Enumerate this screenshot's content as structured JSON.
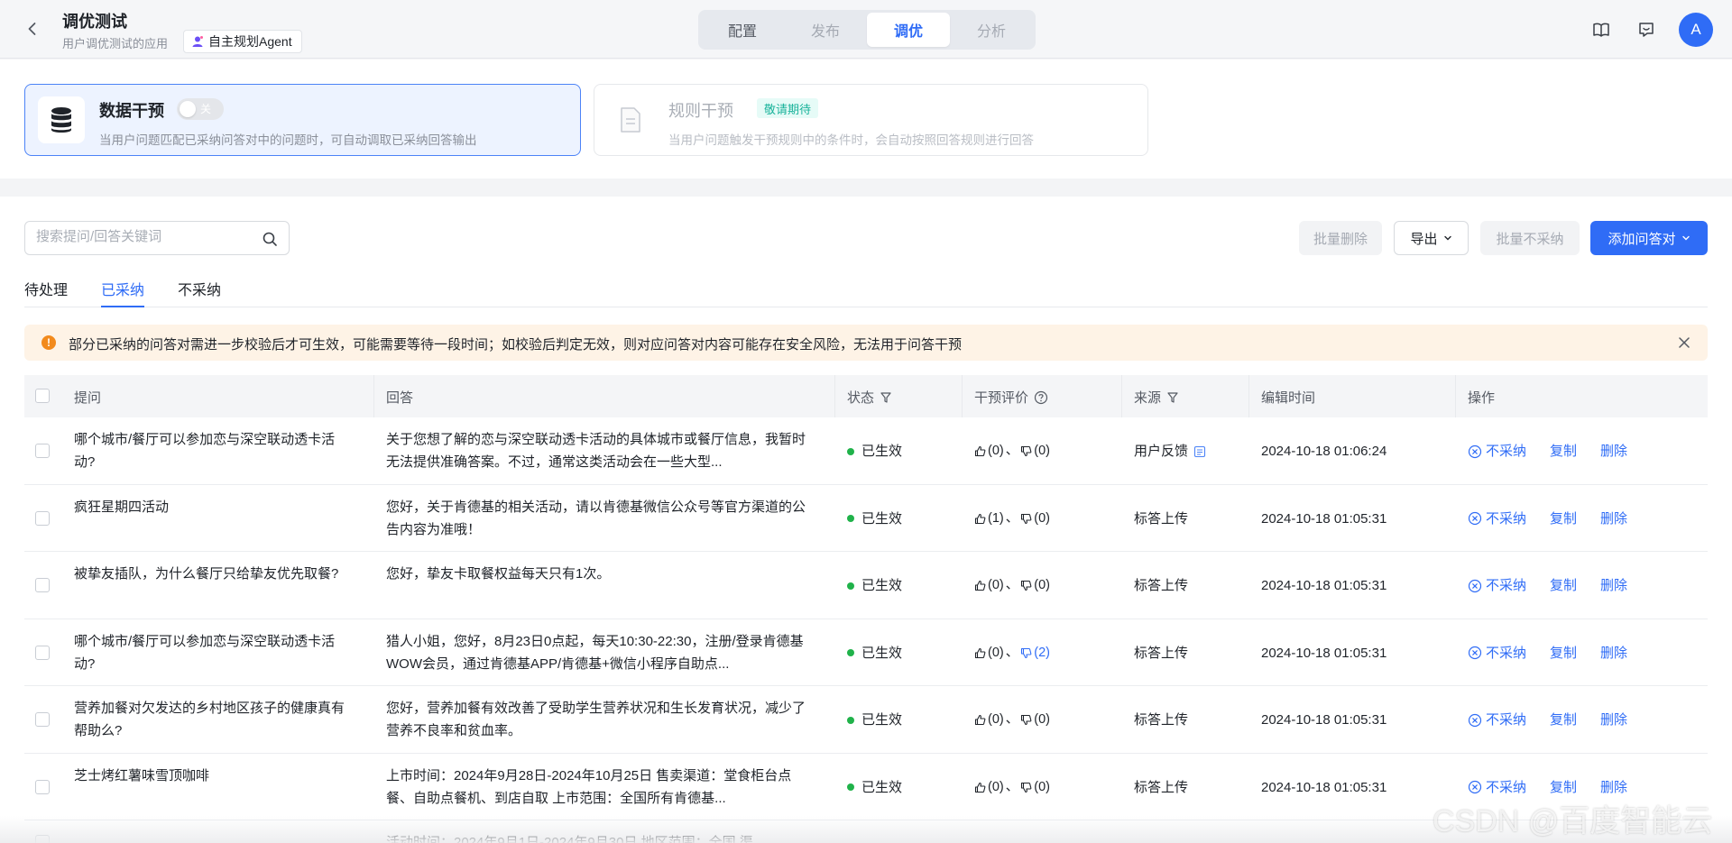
{
  "header": {
    "title": "调优测试",
    "description": "用户调优测试的应用",
    "agent_tag": "自主规划Agent",
    "segments": [
      "配置",
      "发布",
      "调优",
      "分析"
    ],
    "active_segment": "调优",
    "avatar_letter": "A",
    "icons": [
      "back-icon",
      "book-icon",
      "feedback-icon"
    ]
  },
  "cards": {
    "data_intervention": {
      "title": "数据干预",
      "toggle_label": "关",
      "toggle_on": false,
      "description": "当用户问题匹配已采纳问答对中的问题时，可自动调取已采纳回答输出"
    },
    "rule_intervention": {
      "title": "规则干预",
      "badge": "敬请期待",
      "description": "当用户问题触发干预规则中的条件时，会自动按照回答规则进行回答"
    }
  },
  "toolbar": {
    "search_placeholder": "搜索提问/回答关键词",
    "search_value": "",
    "batch_delete": "批量删除",
    "export": "导出",
    "batch_reject": "批量不采纳",
    "add_qa": "添加问答对"
  },
  "tabs": [
    "待处理",
    "已采纳",
    "不采纳"
  ],
  "active_tab": "已采纳",
  "notice": "部分已采纳的问答对需进一步校验后才可生效，可能需要等待一段时间；如校验后判定无效，则对应问答对内容可能存在安全风险，无法用于问答干预",
  "table": {
    "columns": {
      "question": "提问",
      "answer": "回答",
      "status": "状态",
      "evaluation": "干预评价",
      "source": "来源",
      "edit_time": "编辑时间",
      "actions": "操作"
    },
    "action_labels": {
      "reject": "不采纳",
      "copy": "复制",
      "delete": "删除"
    },
    "rows": [
      {
        "question": "哪个城市/餐厅可以参加恋与深空联动透卡活动?",
        "answer": "关于您想了解的恋与深空联动透卡活动的具体城市或餐厅信息，我暂时无法提供准确答案。不过，通常这类活动会在一些大型...",
        "status": "已生效",
        "likes": "(0)",
        "dislikes": "(0)",
        "sep": "、",
        "dislike_highlight": false,
        "source": "用户反馈",
        "source_doc_icon": true,
        "time": "2024-10-18 01:06:24"
      },
      {
        "question": "疯狂星期四活动",
        "answer": "您好，关于肯德基的相关活动，请以肯德基微信公众号等官方渠道的公告内容为准哦！",
        "status": "已生效",
        "likes": "(1)",
        "dislikes": "(0)",
        "sep": "、",
        "dislike_highlight": false,
        "source": "标答上传",
        "source_doc_icon": false,
        "time": "2024-10-18 01:05:31"
      },
      {
        "question": "被挚友插队，为什么餐厅只给挚友优先取餐?",
        "answer": "您好，挚友卡取餐权益每天只有1次。",
        "status": "已生效",
        "likes": "(0)",
        "dislikes": "(0)",
        "sep": "、",
        "dislike_highlight": false,
        "source": "标答上传",
        "source_doc_icon": false,
        "time": "2024-10-18 01:05:31"
      },
      {
        "question": "哪个城市/餐厅可以参加恋与深空联动透卡活动?",
        "answer": "猎人小姐，您好，8月23日0点起，每天10:30-22:30，注册/登录肯德基WOW会员，通过肯德基APP/肯德基+微信小程序自助点...",
        "status": "已生效",
        "likes": "(0)",
        "dislikes": "(2)",
        "sep": "、",
        "dislike_highlight": true,
        "source": "标答上传",
        "source_doc_icon": false,
        "time": "2024-10-18 01:05:31"
      },
      {
        "question": "营养加餐对欠发达的乡村地区孩子的健康真有帮助么?",
        "answer": "您好，营养加餐有效改善了受助学生营养状况和生长发育状况，减少了营养不良率和贫血率。",
        "status": "已生效",
        "likes": "(0)",
        "dislikes": "(0)",
        "sep": "、",
        "dislike_highlight": false,
        "source": "标答上传",
        "source_doc_icon": false,
        "time": "2024-10-18 01:05:31"
      },
      {
        "question": "芝士烤红薯味雪顶咖啡",
        "answer": "上市时间：2024年9月28日-2024年10月25日 售卖渠道：堂食柜台点餐、自助点餐机、到店自取 上市范围：全国所有肯德基...",
        "status": "已生效",
        "likes": "(0)",
        "dislikes": "(0)",
        "sep": "、",
        "dislike_highlight": false,
        "source": "标答上传",
        "source_doc_icon": false,
        "time": "2024-10-18 01:05:31"
      }
    ],
    "partial_row_answer": "活动时间：2024年9月1日-2024年9月30日 地区范围：全国 渠"
  },
  "watermark": "CSDN @百度智能云",
  "colors": {
    "primary": "#2f6cf6",
    "success_dot": "#20b24a",
    "warning": "#f28a1c",
    "notice_bg": "#fef3e6",
    "badge_teal": "#1ab39b"
  }
}
